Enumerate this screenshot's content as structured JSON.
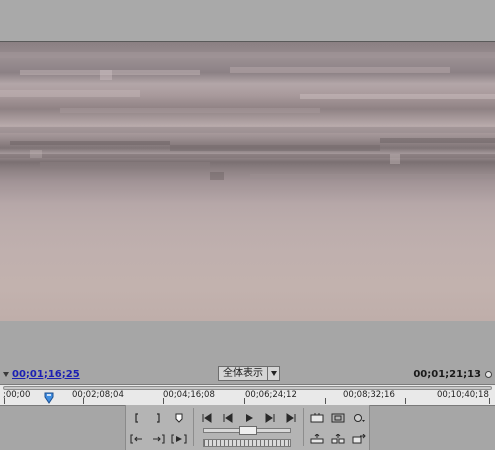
{
  "monitor": {
    "current_timecode": "00;01;16;25",
    "zoom_value": "全体表示",
    "duration_timecode": "00;01;21;13"
  },
  "ruler": {
    "labels": [
      ";00;00",
      "00;02;08;04",
      "00;04;16;08",
      "00;06;24;12",
      "00;08;32;16",
      "00;10;40;18"
    ],
    "playhead_position_fraction": 0.0936
  },
  "controls": {
    "row1": [
      "set-in-point",
      "set-out-point",
      "set-marker",
      "go-to-in-point",
      "step-back",
      "play",
      "step-forward",
      "go-to-out-point",
      "trim-monitor",
      "safe-margins",
      "output"
    ],
    "row2": [
      "go-to-previous-marker",
      "go-to-next-marker",
      "play-in-to-out",
      "lift",
      "extract",
      "export-frame"
    ]
  },
  "colors": {
    "panel": "#a6a6a6",
    "timecode_link": "#1b1fb3",
    "ruler_bg": "#e9e9e9",
    "playhead": "#3f8de0"
  }
}
